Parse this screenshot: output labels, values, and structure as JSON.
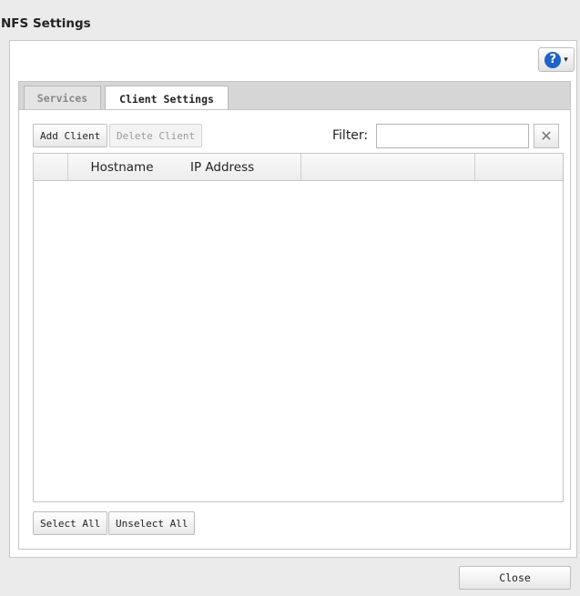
{
  "window": {
    "title": "NFS Settings"
  },
  "help": {
    "glyph": "?",
    "caret": "▾",
    "icon": "help-icon"
  },
  "tabs": [
    {
      "label": "Services",
      "active": false
    },
    {
      "label": "Client Settings",
      "active": true
    }
  ],
  "toolbar": {
    "add_label": "Add Client",
    "delete_label": "Delete Client",
    "delete_disabled": true,
    "filter_label": "Filter:",
    "filter_value": "",
    "clear_glyph": "✕"
  },
  "grid": {
    "columns": [
      "",
      "Hostname",
      "IP Address",
      "",
      ""
    ],
    "rows": []
  },
  "footer": {
    "select_all_label": "Select All",
    "unselect_all_label": "Unselect All"
  },
  "dialog": {
    "close_label": "Close"
  },
  "colors": {
    "accent": "#1e64c8",
    "background": "#ebebeb"
  }
}
